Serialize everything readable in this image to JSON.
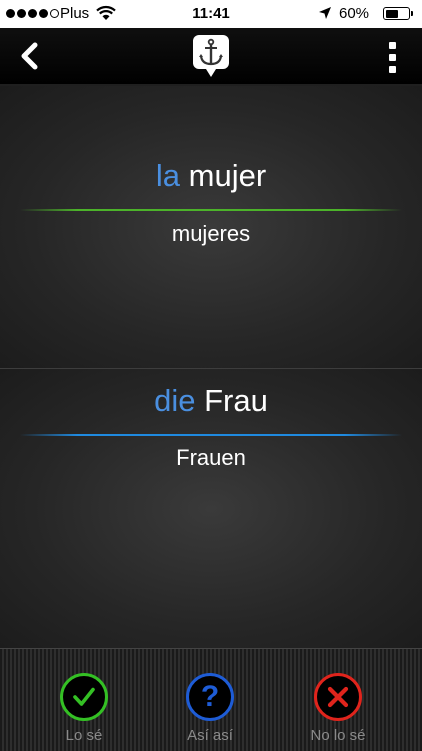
{
  "status_bar": {
    "carrier": "Plus",
    "time": "11:41",
    "battery_percent": "60%",
    "battery_level": 0.6,
    "signal_bars_filled": 4,
    "signal_bars_total": 5
  },
  "nav": {
    "back_icon": "chevron-left-icon",
    "logo_icon": "anchor-speech-bubble-icon",
    "menu_icon": "vertical-dots-icon"
  },
  "card_source": {
    "article": "la",
    "noun": "mujer",
    "plural": "mujeres",
    "divider_color": "#4cb32a"
  },
  "card_target": {
    "article": "die",
    "noun": "Frau",
    "plural": "Frauen",
    "divider_color": "#1f8ae0"
  },
  "toolbar": {
    "know_label": "Lo sé",
    "somewhat_label": "Así así",
    "dont_know_label": "No lo sé"
  },
  "colors": {
    "article_blue": "#4a8fe0",
    "know_green": "#34c024",
    "somewhat_blue": "#1e5cd6",
    "dont_know_red": "#e0241c"
  }
}
